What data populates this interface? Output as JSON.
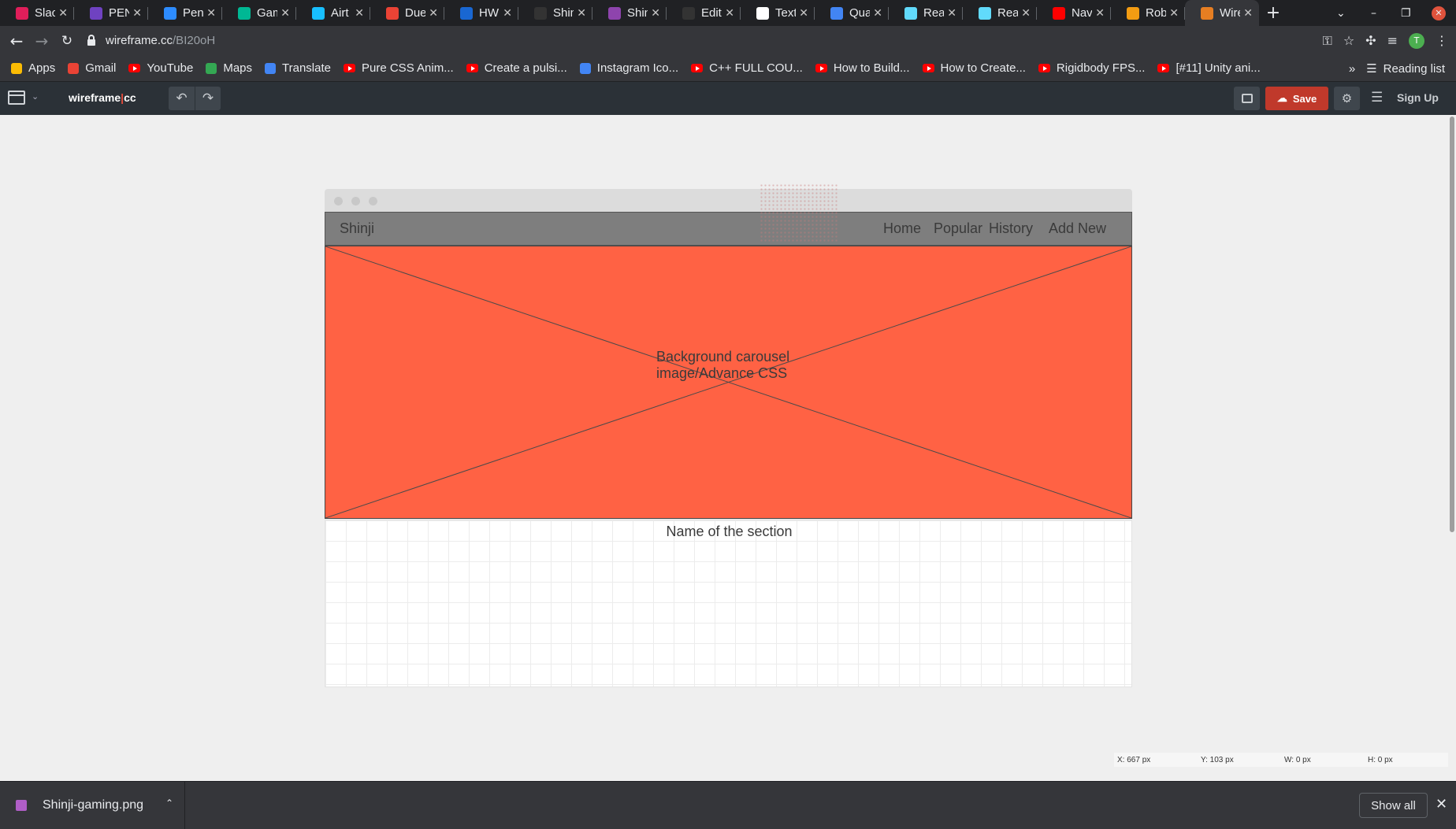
{
  "browser": {
    "tabs": [
      {
        "label": "Slack",
        "color": "#e01e5a"
      },
      {
        "label": "PEN",
        "color": "#6f42c1"
      },
      {
        "label": "Pen",
        "color": "#2d8cff"
      },
      {
        "label": "Gam",
        "color": "#00b894"
      },
      {
        "label": "Airt",
        "color": "#18bfff"
      },
      {
        "label": "Due",
        "color": "#ea4335"
      },
      {
        "label": "HW",
        "color": "#1967d2"
      },
      {
        "label": "Shin",
        "color": "#333333"
      },
      {
        "label": "Shin",
        "color": "#8e44ad"
      },
      {
        "label": "Editi",
        "color": "#333333"
      },
      {
        "label": "Text",
        "color": "#ffffff"
      },
      {
        "label": "Qua",
        "color": "#4285f4"
      },
      {
        "label": "Reac",
        "color": "#61dafb"
      },
      {
        "label": "Reac",
        "color": "#61dafb"
      },
      {
        "label": "Navi",
        "color": "#ff0000"
      },
      {
        "label": "Rob",
        "color": "#f39c12"
      },
      {
        "label": "Wire",
        "color": "#e67e22",
        "active": true
      }
    ],
    "address": {
      "domain": "wireframe.cc",
      "path": "/BI20oH"
    },
    "profile_initial": "T",
    "bookmarks": [
      {
        "label": "Apps",
        "icon": "apps-grid-icon"
      },
      {
        "label": "Gmail",
        "icon": "gmail-icon"
      },
      {
        "label": "YouTube",
        "icon": "youtube-icon"
      },
      {
        "label": "Maps",
        "icon": "maps-icon"
      },
      {
        "label": "Translate",
        "icon": "translate-icon"
      },
      {
        "label": "Pure CSS Anim...",
        "icon": "youtube-icon"
      },
      {
        "label": "Create a pulsi...",
        "icon": "youtube-icon"
      },
      {
        "label": "Instagram Ico...",
        "icon": "flag-icon"
      },
      {
        "label": "C++ FULL COU...",
        "icon": "youtube-icon"
      },
      {
        "label": "How to Build...",
        "icon": "youtube-icon"
      },
      {
        "label": "How to Create...",
        "icon": "youtube-icon"
      },
      {
        "label": "Rigidbody FPS...",
        "icon": "youtube-icon"
      },
      {
        "label": "[#11] Unity ani...",
        "icon": "youtube-icon"
      }
    ],
    "more_bookmarks": "»",
    "reading_list": "Reading list"
  },
  "app": {
    "logo_left": "wireframe",
    "logo_sep": "|",
    "logo_right": "cc",
    "save_label": "Save",
    "signup_label": "Sign Up"
  },
  "wireframe": {
    "brand": "Shinji",
    "nav": [
      "Home",
      "Popular",
      "History",
      "Add New"
    ],
    "hero_text": "Background carousel image/Advance CSS",
    "hero_color": "#ff6244",
    "section_title": "Name of the section"
  },
  "status": {
    "x": "X: 667 px",
    "y": "Y: 103 px",
    "w": "W: 0 px",
    "h": "H: 0 px"
  },
  "download": {
    "filename": "Shinji-gaming.png",
    "show_all": "Show all"
  }
}
